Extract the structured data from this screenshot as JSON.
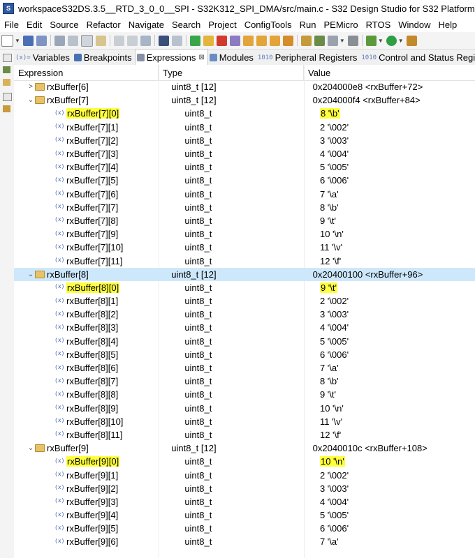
{
  "window": {
    "title": "workspaceS32DS.3.5__RTD_3_0_0__SPI - S32K312_SPI_DMA/src/main.c - S32 Design Studio for S32 Platform",
    "app_icon_label": "S"
  },
  "menu": [
    "File",
    "Edit",
    "Source",
    "Refactor",
    "Navigate",
    "Search",
    "Project",
    "ConfigTools",
    "Run",
    "PEMicro",
    "RTOS",
    "Window",
    "Help"
  ],
  "tabs": [
    {
      "label": "Variables",
      "icon": "variables-icon",
      "icon_text": "(x)=",
      "active": false
    },
    {
      "label": "Breakpoints",
      "icon": "breakpoints-icon",
      "icon_text": "",
      "active": false
    },
    {
      "label": "Expressions",
      "icon": "expressions-icon",
      "icon_text": "",
      "active": true,
      "close": "⊠"
    },
    {
      "label": "Modules",
      "icon": "modules-icon",
      "icon_text": "",
      "active": false
    },
    {
      "label": "Peripheral Registers",
      "icon": "peripheral-registers-icon",
      "icon_text": "1010",
      "active": false
    },
    {
      "label": "Control and Status Registers",
      "icon": "control-status-registers-icon",
      "icon_text": "1010",
      "active": false
    }
  ],
  "columns": {
    "expression": "Expression",
    "type": "Type",
    "value": "Value"
  },
  "rows": [
    {
      "name": "rxBuffer[6]",
      "type": "uint8_t [12]",
      "value": "0x204000e8 <rxBuffer+72>",
      "level": 0,
      "twisty": ">",
      "icon": "folder",
      "hl_name": false,
      "hl_value": false,
      "selected": false
    },
    {
      "name": "rxBuffer[7]",
      "type": "uint8_t [12]",
      "value": "0x204000f4 <rxBuffer+84>",
      "level": 0,
      "twisty": "⌄",
      "icon": "folder",
      "hl_name": false,
      "hl_value": false,
      "selected": false
    },
    {
      "name": "rxBuffer[7][0]",
      "type": "uint8_t",
      "value": "8 '\\b'",
      "level": 1,
      "twisty": "",
      "icon": "var",
      "hl_name": true,
      "hl_value": true,
      "selected": false
    },
    {
      "name": "rxBuffer[7][1]",
      "type": "uint8_t",
      "value": "2 '\\002'",
      "level": 1,
      "twisty": "",
      "icon": "var",
      "hl_name": false,
      "hl_value": false,
      "selected": false
    },
    {
      "name": "rxBuffer[7][2]",
      "type": "uint8_t",
      "value": "3 '\\003'",
      "level": 1,
      "twisty": "",
      "icon": "var",
      "hl_name": false,
      "hl_value": false,
      "selected": false
    },
    {
      "name": "rxBuffer[7][3]",
      "type": "uint8_t",
      "value": "4 '\\004'",
      "level": 1,
      "twisty": "",
      "icon": "var",
      "hl_name": false,
      "hl_value": false,
      "selected": false
    },
    {
      "name": "rxBuffer[7][4]",
      "type": "uint8_t",
      "value": "5 '\\005'",
      "level": 1,
      "twisty": "",
      "icon": "var",
      "hl_name": false,
      "hl_value": false,
      "selected": false
    },
    {
      "name": "rxBuffer[7][5]",
      "type": "uint8_t",
      "value": "6 '\\006'",
      "level": 1,
      "twisty": "",
      "icon": "var",
      "hl_name": false,
      "hl_value": false,
      "selected": false
    },
    {
      "name": "rxBuffer[7][6]",
      "type": "uint8_t",
      "value": "7 '\\a'",
      "level": 1,
      "twisty": "",
      "icon": "var",
      "hl_name": false,
      "hl_value": false,
      "selected": false
    },
    {
      "name": "rxBuffer[7][7]",
      "type": "uint8_t",
      "value": "8 '\\b'",
      "level": 1,
      "twisty": "",
      "icon": "var",
      "hl_name": false,
      "hl_value": false,
      "selected": false
    },
    {
      "name": "rxBuffer[7][8]",
      "type": "uint8_t",
      "value": "9 '\\t'",
      "level": 1,
      "twisty": "",
      "icon": "var",
      "hl_name": false,
      "hl_value": false,
      "selected": false
    },
    {
      "name": "rxBuffer[7][9]",
      "type": "uint8_t",
      "value": "10 '\\n'",
      "level": 1,
      "twisty": "",
      "icon": "var",
      "hl_name": false,
      "hl_value": false,
      "selected": false
    },
    {
      "name": "rxBuffer[7][10]",
      "type": "uint8_t",
      "value": "11 '\\v'",
      "level": 1,
      "twisty": "",
      "icon": "var",
      "hl_name": false,
      "hl_value": false,
      "selected": false
    },
    {
      "name": "rxBuffer[7][11]",
      "type": "uint8_t",
      "value": "12 '\\f'",
      "level": 1,
      "twisty": "",
      "icon": "var",
      "hl_name": false,
      "hl_value": false,
      "selected": false
    },
    {
      "name": "rxBuffer[8]",
      "type": "uint8_t [12]",
      "value": "0x20400100 <rxBuffer+96>",
      "level": 0,
      "twisty": "⌄",
      "icon": "folder",
      "hl_name": false,
      "hl_value": false,
      "selected": true
    },
    {
      "name": "rxBuffer[8][0]",
      "type": "uint8_t",
      "value": "9 '\\t'",
      "level": 1,
      "twisty": "",
      "icon": "var",
      "hl_name": true,
      "hl_value": true,
      "selected": false
    },
    {
      "name": "rxBuffer[8][1]",
      "type": "uint8_t",
      "value": "2 '\\002'",
      "level": 1,
      "twisty": "",
      "icon": "var",
      "hl_name": false,
      "hl_value": false,
      "selected": false
    },
    {
      "name": "rxBuffer[8][2]",
      "type": "uint8_t",
      "value": "3 '\\003'",
      "level": 1,
      "twisty": "",
      "icon": "var",
      "hl_name": false,
      "hl_value": false,
      "selected": false
    },
    {
      "name": "rxBuffer[8][3]",
      "type": "uint8_t",
      "value": "4 '\\004'",
      "level": 1,
      "twisty": "",
      "icon": "var",
      "hl_name": false,
      "hl_value": false,
      "selected": false
    },
    {
      "name": "rxBuffer[8][4]",
      "type": "uint8_t",
      "value": "5 '\\005'",
      "level": 1,
      "twisty": "",
      "icon": "var",
      "hl_name": false,
      "hl_value": false,
      "selected": false
    },
    {
      "name": "rxBuffer[8][5]",
      "type": "uint8_t",
      "value": "6 '\\006'",
      "level": 1,
      "twisty": "",
      "icon": "var",
      "hl_name": false,
      "hl_value": false,
      "selected": false
    },
    {
      "name": "rxBuffer[8][6]",
      "type": "uint8_t",
      "value": "7 '\\a'",
      "level": 1,
      "twisty": "",
      "icon": "var",
      "hl_name": false,
      "hl_value": false,
      "selected": false
    },
    {
      "name": "rxBuffer[8][7]",
      "type": "uint8_t",
      "value": "8 '\\b'",
      "level": 1,
      "twisty": "",
      "icon": "var",
      "hl_name": false,
      "hl_value": false,
      "selected": false
    },
    {
      "name": "rxBuffer[8][8]",
      "type": "uint8_t",
      "value": "9 '\\t'",
      "level": 1,
      "twisty": "",
      "icon": "var",
      "hl_name": false,
      "hl_value": false,
      "selected": false
    },
    {
      "name": "rxBuffer[8][9]",
      "type": "uint8_t",
      "value": "10 '\\n'",
      "level": 1,
      "twisty": "",
      "icon": "var",
      "hl_name": false,
      "hl_value": false,
      "selected": false
    },
    {
      "name": "rxBuffer[8][10]",
      "type": "uint8_t",
      "value": "11 '\\v'",
      "level": 1,
      "twisty": "",
      "icon": "var",
      "hl_name": false,
      "hl_value": false,
      "selected": false
    },
    {
      "name": "rxBuffer[8][11]",
      "type": "uint8_t",
      "value": "12 '\\f'",
      "level": 1,
      "twisty": "",
      "icon": "var",
      "hl_name": false,
      "hl_value": false,
      "selected": false
    },
    {
      "name": "rxBuffer[9]",
      "type": "uint8_t [12]",
      "value": "0x2040010c <rxBuffer+108>",
      "level": 0,
      "twisty": "⌄",
      "icon": "folder",
      "hl_name": false,
      "hl_value": false,
      "selected": false
    },
    {
      "name": "rxBuffer[9][0]",
      "type": "uint8_t",
      "value": "10 '\\n'",
      "level": 1,
      "twisty": "",
      "icon": "var",
      "hl_name": true,
      "hl_value": true,
      "selected": false
    },
    {
      "name": "rxBuffer[9][1]",
      "type": "uint8_t",
      "value": "2 '\\002'",
      "level": 1,
      "twisty": "",
      "icon": "var",
      "hl_name": false,
      "hl_value": false,
      "selected": false
    },
    {
      "name": "rxBuffer[9][2]",
      "type": "uint8_t",
      "value": "3 '\\003'",
      "level": 1,
      "twisty": "",
      "icon": "var",
      "hl_name": false,
      "hl_value": false,
      "selected": false
    },
    {
      "name": "rxBuffer[9][3]",
      "type": "uint8_t",
      "value": "4 '\\004'",
      "level": 1,
      "twisty": "",
      "icon": "var",
      "hl_name": false,
      "hl_value": false,
      "selected": false
    },
    {
      "name": "rxBuffer[9][4]",
      "type": "uint8_t",
      "value": "5 '\\005'",
      "level": 1,
      "twisty": "",
      "icon": "var",
      "hl_name": false,
      "hl_value": false,
      "selected": false
    },
    {
      "name": "rxBuffer[9][5]",
      "type": "uint8_t",
      "value": "6 '\\006'",
      "level": 1,
      "twisty": "",
      "icon": "var",
      "hl_name": false,
      "hl_value": false,
      "selected": false
    },
    {
      "name": "rxBuffer[9][6]",
      "type": "uint8_t",
      "value": "7 '\\a'",
      "level": 1,
      "twisty": "",
      "icon": "var",
      "hl_name": false,
      "hl_value": false,
      "selected": false
    }
  ],
  "colors": {
    "highlight": "#ffff3d",
    "selection": "#cde8fb",
    "folder": "#e8c26a",
    "var_icon": "#3b5fa8"
  }
}
